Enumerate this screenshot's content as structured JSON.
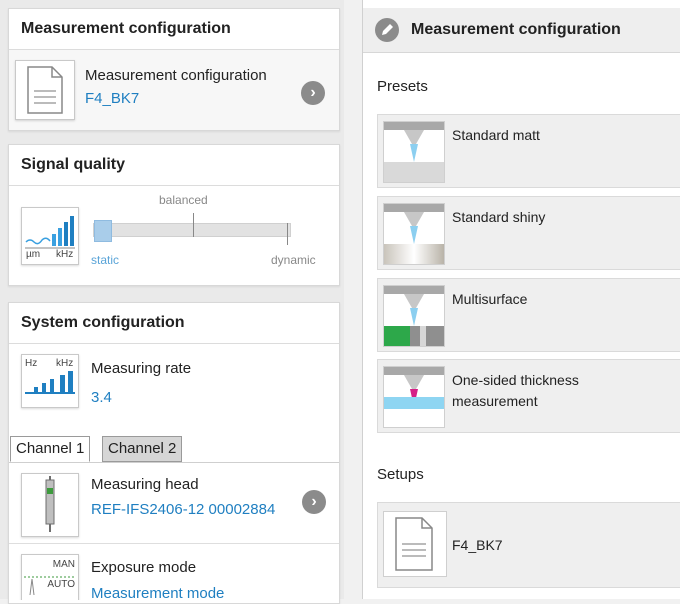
{
  "left": {
    "measurement_panel": {
      "title": "Measurement configuration",
      "item_title": "Measurement configuration",
      "item_value": "F4_BK7"
    },
    "signal_panel": {
      "title": "Signal quality",
      "unit_left": "µm",
      "unit_right": "kHz",
      "slider_levels": [
        "static",
        "balanced",
        "dynamic"
      ],
      "selected_level": "static"
    },
    "system_panel": {
      "title": "System configuration",
      "rate_unit_left": "Hz",
      "rate_unit_right": "kHz",
      "rate_title": "Measuring rate",
      "rate_value": "3.4"
    },
    "tabs": [
      "Channel 1",
      "Channel 2"
    ],
    "active_tab": "Channel 1",
    "head_title": "Measuring head",
    "head_value": "REF-IFS2406-12 00002884",
    "exposure_icon_top": "MAN",
    "exposure_icon_bottom": "AUTO",
    "exposure_title": "Exposure mode",
    "exposure_value": "Measurement mode"
  },
  "right": {
    "header_title": "Measurement configuration",
    "presets_label": "Presets",
    "presets": [
      {
        "label": "Standard matt",
        "icon": "matt-surface-icon"
      },
      {
        "label": "Standard shiny",
        "icon": "shiny-surface-icon"
      },
      {
        "label": "Multisurface",
        "icon": "multisurface-icon"
      },
      {
        "label": "One-sided thickness measurement",
        "icon": "thickness-icon"
      }
    ],
    "setups_label": "Setups",
    "setups": [
      {
        "label": "F4_BK7",
        "icon": "document-icon"
      }
    ]
  },
  "colors": {
    "accent": "#1f7fc1",
    "chevron": "#8b8b8b",
    "panel_bg": "#ffffff"
  }
}
